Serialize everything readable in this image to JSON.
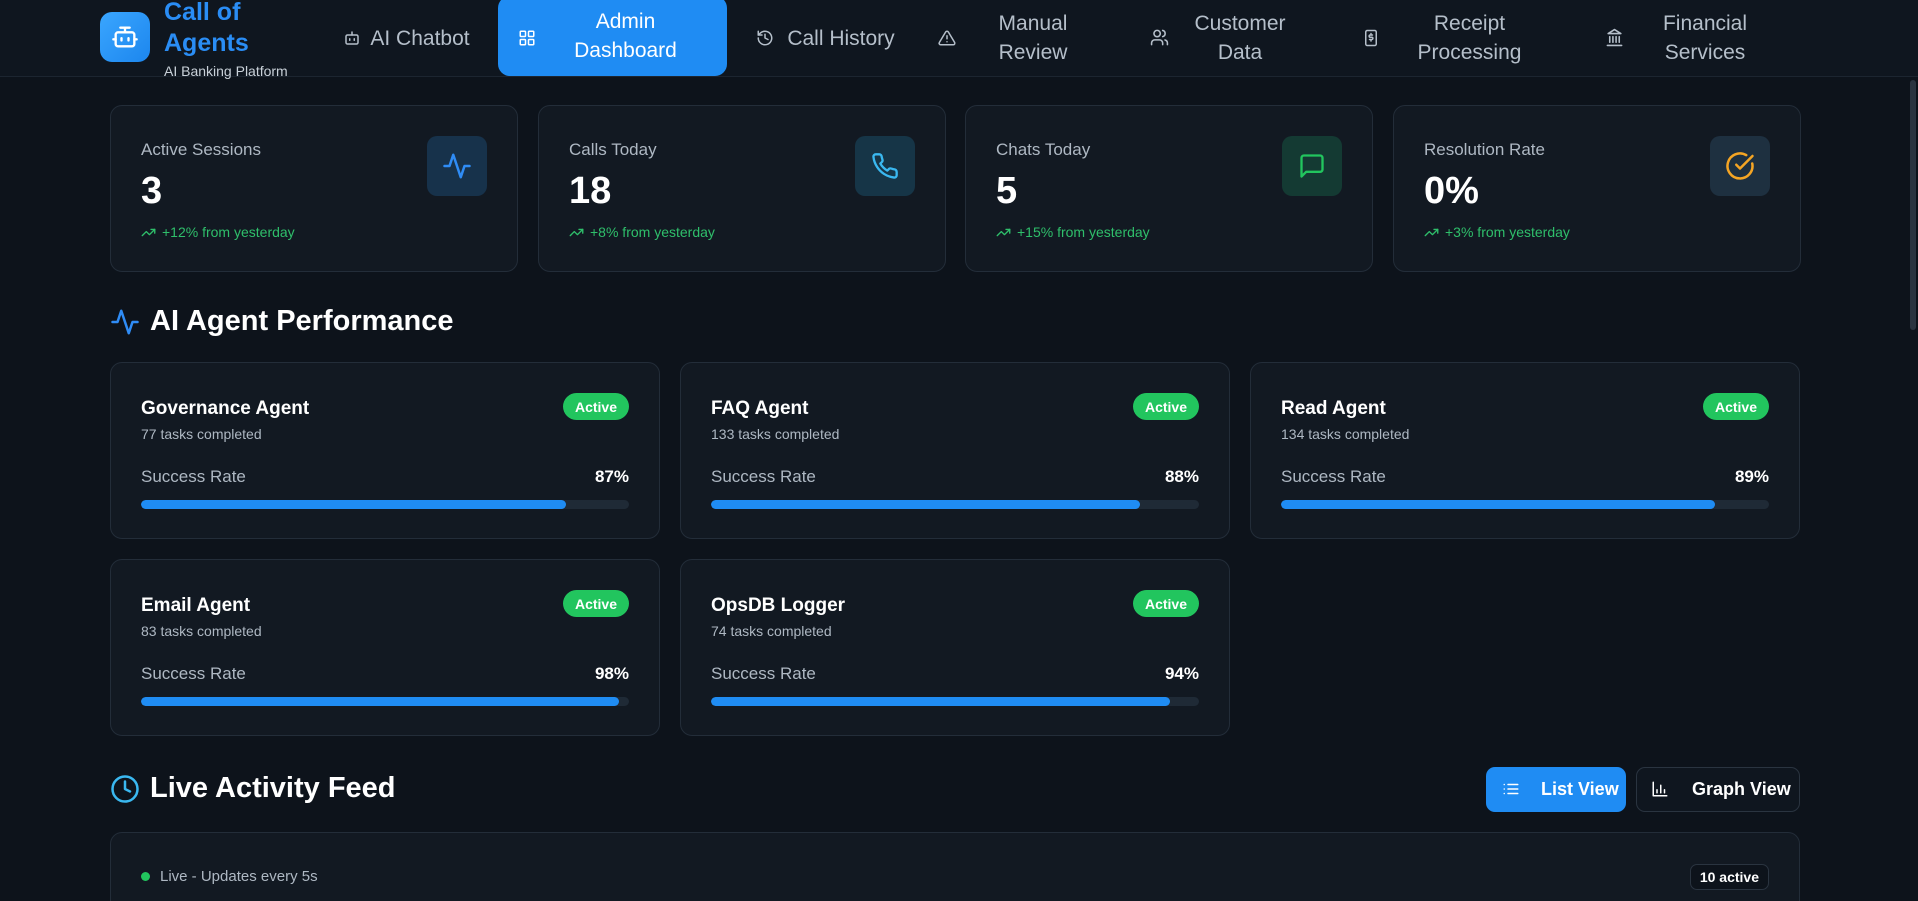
{
  "brand": {
    "title": "Call of Agents",
    "subtitle": "AI Banking Platform",
    "icon": "robot-icon"
  },
  "nav": [
    {
      "label": "AI Chatbot",
      "icon": "bot-icon",
      "active": false
    },
    {
      "label": "Admin Dashboard",
      "icon": "grid-icon",
      "active": true
    },
    {
      "label": "Call History",
      "icon": "history-icon",
      "active": false
    },
    {
      "label": "Manual Review",
      "icon": "alert-triangle-icon",
      "active": false
    },
    {
      "label": "Customer Data",
      "icon": "users-icon",
      "active": false
    },
    {
      "label": "Receipt Processing",
      "icon": "receipt-icon",
      "active": false
    },
    {
      "label": "Financial Services",
      "icon": "bank-icon",
      "active": false
    }
  ],
  "stats": [
    {
      "label": "Active Sessions",
      "value": "3",
      "trend": "+12% from yesterday",
      "icon": "activity-icon",
      "color": "#2f8cf5"
    },
    {
      "label": "Calls Today",
      "value": "18",
      "trend": "+8% from yesterday",
      "icon": "phone-icon",
      "color": "#3ab8f0"
    },
    {
      "label": "Chats Today",
      "value": "5",
      "trend": "+15% from yesterday",
      "icon": "message-icon",
      "color": "#22c55e"
    },
    {
      "label": "Resolution Rate",
      "value": "0%",
      "trend": "+3% from yesterday",
      "icon": "check-circle-icon",
      "color": "#f5a524"
    }
  ],
  "performance": {
    "title": "AI Agent Performance",
    "rate_label": "Success Rate",
    "agents": [
      {
        "name": "Governance Agent",
        "tasks": "77 tasks completed",
        "status": "Active",
        "rate": "87%",
        "rate_value": 87
      },
      {
        "name": "FAQ Agent",
        "tasks": "133 tasks completed",
        "status": "Active",
        "rate": "88%",
        "rate_value": 88
      },
      {
        "name": "Read Agent",
        "tasks": "134 tasks completed",
        "status": "Active",
        "rate": "89%",
        "rate_value": 89
      },
      {
        "name": "Email Agent",
        "tasks": "83 tasks completed",
        "status": "Active",
        "rate": "98%",
        "rate_value": 98
      },
      {
        "name": "OpsDB Logger",
        "tasks": "74 tasks completed",
        "status": "Active",
        "rate": "94%",
        "rate_value": 94
      }
    ]
  },
  "feed": {
    "title": "Live Activity Feed",
    "list_view": "List View",
    "graph_view": "Graph View",
    "status": "Live - Updates every 5s",
    "active_badge": "10 active"
  },
  "colors": {
    "accent": "#1f8cf3",
    "success": "#22c55e",
    "background": "#0d131b"
  }
}
